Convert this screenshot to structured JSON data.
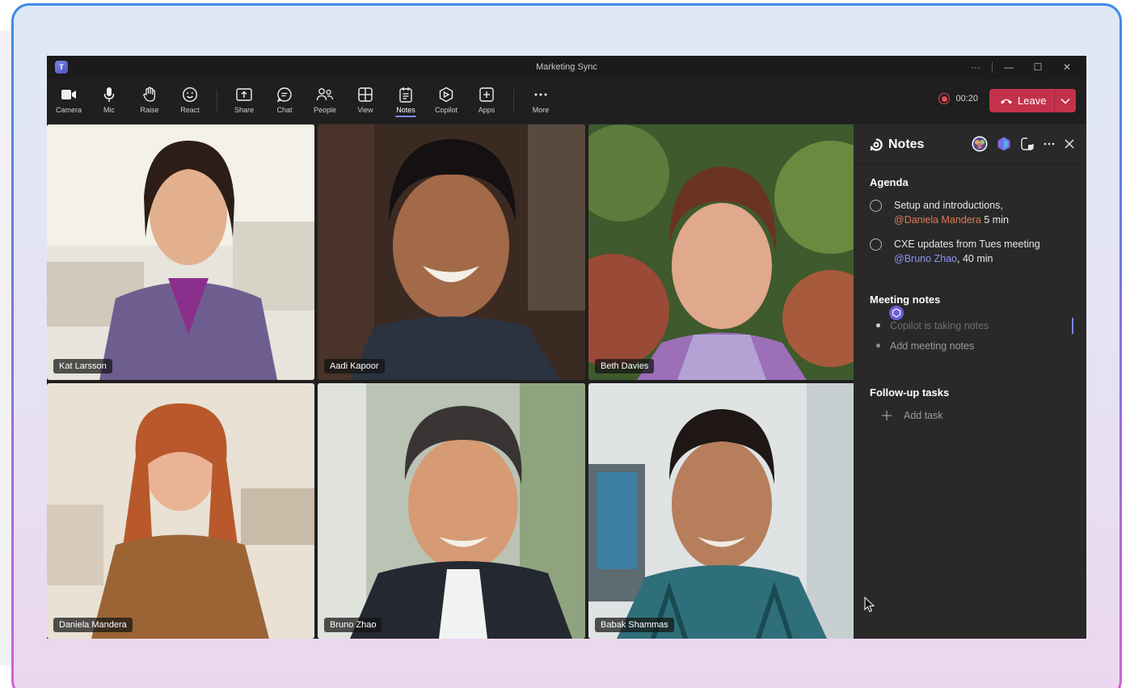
{
  "window": {
    "title": "Marketing Sync",
    "app_logo": "T"
  },
  "window_controls": {
    "more": "···",
    "minimize": "—",
    "maximize": "☐",
    "close": "✕"
  },
  "toolbar": {
    "items": [
      {
        "label": "Camera",
        "icon": "camera-icon"
      },
      {
        "label": "Mic",
        "icon": "mic-icon"
      },
      {
        "label": "Raise",
        "icon": "hand-icon"
      },
      {
        "label": "React",
        "icon": "smiley-icon"
      },
      {
        "label": "Share",
        "icon": "share-icon"
      },
      {
        "label": "Chat",
        "icon": "chat-icon"
      },
      {
        "label": "People",
        "icon": "people-icon"
      },
      {
        "label": "View",
        "icon": "grid-icon"
      },
      {
        "label": "Notes",
        "icon": "notes-icon",
        "active": true
      },
      {
        "label": "Copilot",
        "icon": "copilot-icon"
      },
      {
        "label": "Apps",
        "icon": "apps-icon"
      },
      {
        "label": "More",
        "icon": "ellipsis-icon"
      }
    ],
    "recording_time": "00:20",
    "leave_label": "Leave"
  },
  "participants": [
    {
      "name": "Kat Larsson"
    },
    {
      "name": "Aadi Kapoor"
    },
    {
      "name": "Beth Davies"
    },
    {
      "name": "Daniela Mandera"
    },
    {
      "name": "Bruno Zhao"
    },
    {
      "name": "Babak Shammas"
    }
  ],
  "notes_panel": {
    "title": "Notes",
    "agenda_title": "Agenda",
    "agenda": [
      {
        "text": "Setup and introductions,",
        "mention": "@Daniela Mandera",
        "duration": "5 min"
      },
      {
        "text": "CXE updates from Tues meeting",
        "mention": "@Bruno Zhao",
        "duration": ", 40 min"
      }
    ],
    "meeting_notes_title": "Meeting notes",
    "copilot_status": "Copilot is taking notes",
    "add_notes_placeholder": "Add meeting notes",
    "followup_title": "Follow-up tasks",
    "add_task_label": "Add task"
  },
  "colors": {
    "accent": "#7f85f5",
    "leave": "#c4314b",
    "record": "#e34b52",
    "mention_orange": "#e07a52",
    "mention_blue": "#8b93f0"
  }
}
